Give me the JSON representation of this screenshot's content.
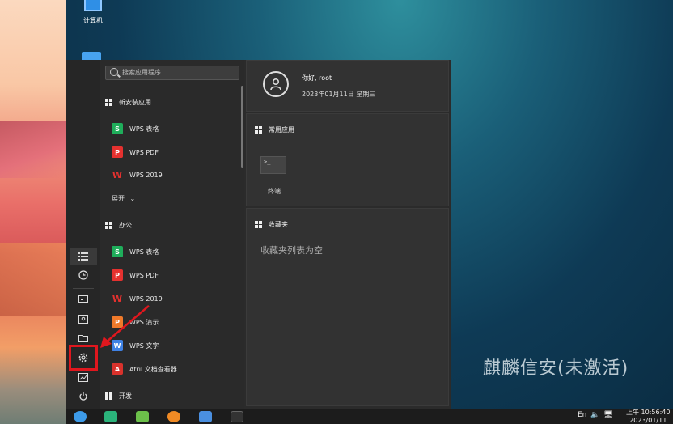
{
  "desktop": {
    "computer_label": "计算机",
    "watermark": "麒麟信安(未激活)"
  },
  "search": {
    "placeholder": "搜索应用程序"
  },
  "groups": {
    "recent": "新安装应用",
    "office": "办公",
    "dev": "开发"
  },
  "recent_apps": [
    "WPS 表格",
    "WPS PDF",
    "WPS 2019"
  ],
  "expand_label": "展开",
  "office_apps": [
    "WPS 表格",
    "WPS PDF",
    "WPS 2019",
    "WPS 演示",
    "WPS 文字",
    "Atril 文档查看器"
  ],
  "user": {
    "greeting": "你好, root",
    "date": "2023年01月11日 星期三"
  },
  "common": {
    "title": "常用应用",
    "terminal_label": "终端",
    "terminal_glyph": ">_"
  },
  "favorites": {
    "title": "收藏夹",
    "empty": "收藏夹列表为空"
  },
  "taskbar": {
    "lang": "En",
    "time": "上午 10:56:40",
    "date": "2023/01/11"
  },
  "colors": {
    "highlight": "#e0171e",
    "wps_sheet": "#1fae5b",
    "wps_pdf": "#e5312f",
    "wps_2019": "#e5312f",
    "wps_ppt": "#f07a2a",
    "wps_doc": "#3f82e5",
    "atril": "#d9322c"
  }
}
